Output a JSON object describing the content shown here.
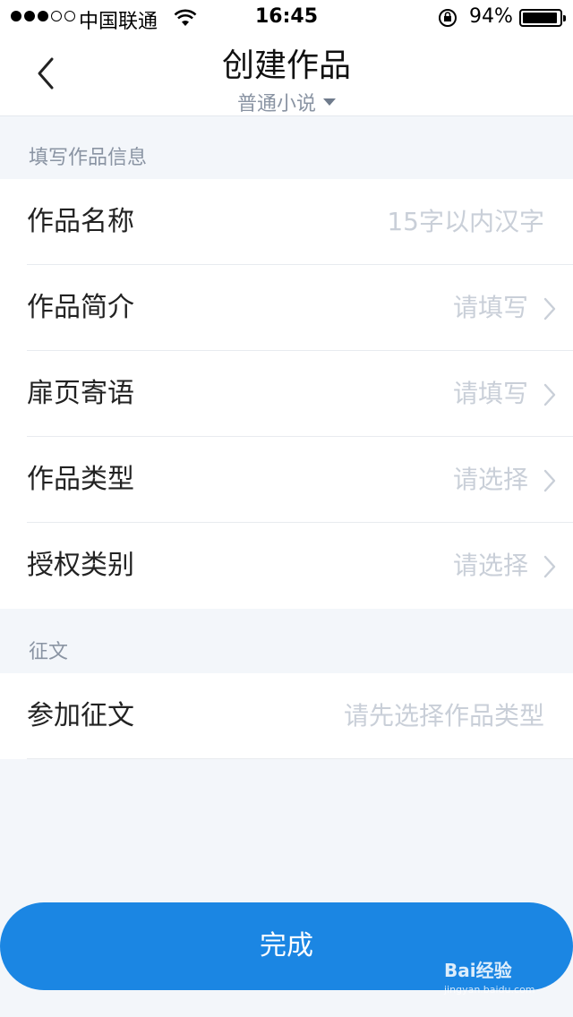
{
  "status_bar": {
    "carrier": "中国联通",
    "time": "16:45",
    "battery_percent": "94%",
    "battery_level": 0.94,
    "signal_bars": 3,
    "signal_total": 5,
    "icons": [
      "wifi-icon",
      "rotation-lock-icon",
      "battery-icon"
    ]
  },
  "nav": {
    "title": "创建作品",
    "subtitle": "普通小说",
    "back_icon": "chevron-left-icon",
    "dropdown_icon": "caret-down-icon"
  },
  "sections": {
    "info_header": "填写作品信息",
    "contest_header": "征文"
  },
  "info_rows": [
    {
      "label": "作品名称",
      "value": "15字以内汉字"
    },
    {
      "label": "作品简介",
      "value": "请填写"
    },
    {
      "label": "扉页寄语",
      "value": "请填写"
    },
    {
      "label": "作品类型",
      "value": "请选择"
    },
    {
      "label": "授权类别",
      "value": "请选择"
    }
  ],
  "contest_row": {
    "label": "参加征文",
    "value": "请先选择作品类型"
  },
  "done_button": {
    "label": "完成"
  },
  "watermark": {
    "brand": "Bai经验",
    "site": "jingyan.baidu.com"
  },
  "colors": {
    "accent": "#1b86e3",
    "background": "#f3f6fa",
    "placeholder": "#c9cfd8",
    "section_header": "#8a94a3"
  }
}
